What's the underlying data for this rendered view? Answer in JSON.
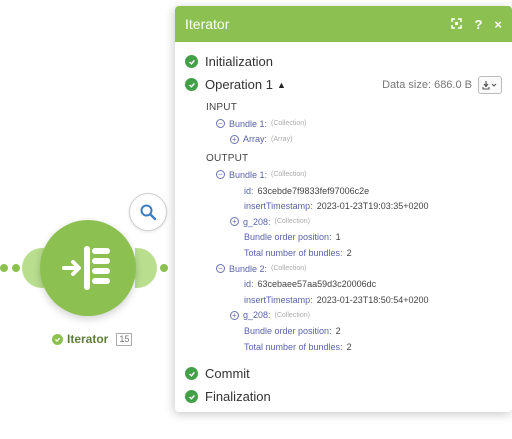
{
  "module": {
    "name": "Iterator",
    "id": "15"
  },
  "panel": {
    "title": "Iterator",
    "header_buttons": [
      "expand-icon",
      "help-icon",
      "close-icon"
    ],
    "help_label": "?",
    "close_label": "×",
    "initialization": "Initialization",
    "operation": "Operation 1",
    "data_size": "Data size: 686.0 B",
    "input_label": "INPUT",
    "output_label": "OUTPUT",
    "input": {
      "bundle": "Bundle 1:",
      "bundle_type": "(Collection)",
      "array_key": "Array:",
      "array_type": "(Array)"
    },
    "output": [
      {
        "bundle": "Bundle 1:",
        "bundle_type": "(Collection)",
        "id_key": "id:",
        "id_val": "63cebde7f9833fef97006c2e",
        "ts_key": "insertTimestamp:",
        "ts_val": "2023-01-23T19:03:35+0200",
        "g_key": "g_208:",
        "g_type": "(Collection)",
        "pos_key": "Bundle order position:",
        "pos_val": "1",
        "total_key": "Total number of bundles:",
        "total_val": "2"
      },
      {
        "bundle": "Bundle 2:",
        "bundle_type": "(Collection)",
        "id_key": "id:",
        "id_val": "63cebaee57aa59d3c20006dc",
        "ts_key": "insertTimestamp:",
        "ts_val": "2023-01-23T18:50:54+0200",
        "g_key": "g_208:",
        "g_type": "(Collection)",
        "pos_key": "Bundle order position:",
        "pos_val": "2",
        "total_key": "Total number of bundles:",
        "total_val": "2"
      }
    ],
    "commit": "Commit",
    "finalization": "Finalization"
  },
  "colors": {
    "accent": "#8cc152",
    "check": "#43a047",
    "key": "#5a63a8"
  }
}
